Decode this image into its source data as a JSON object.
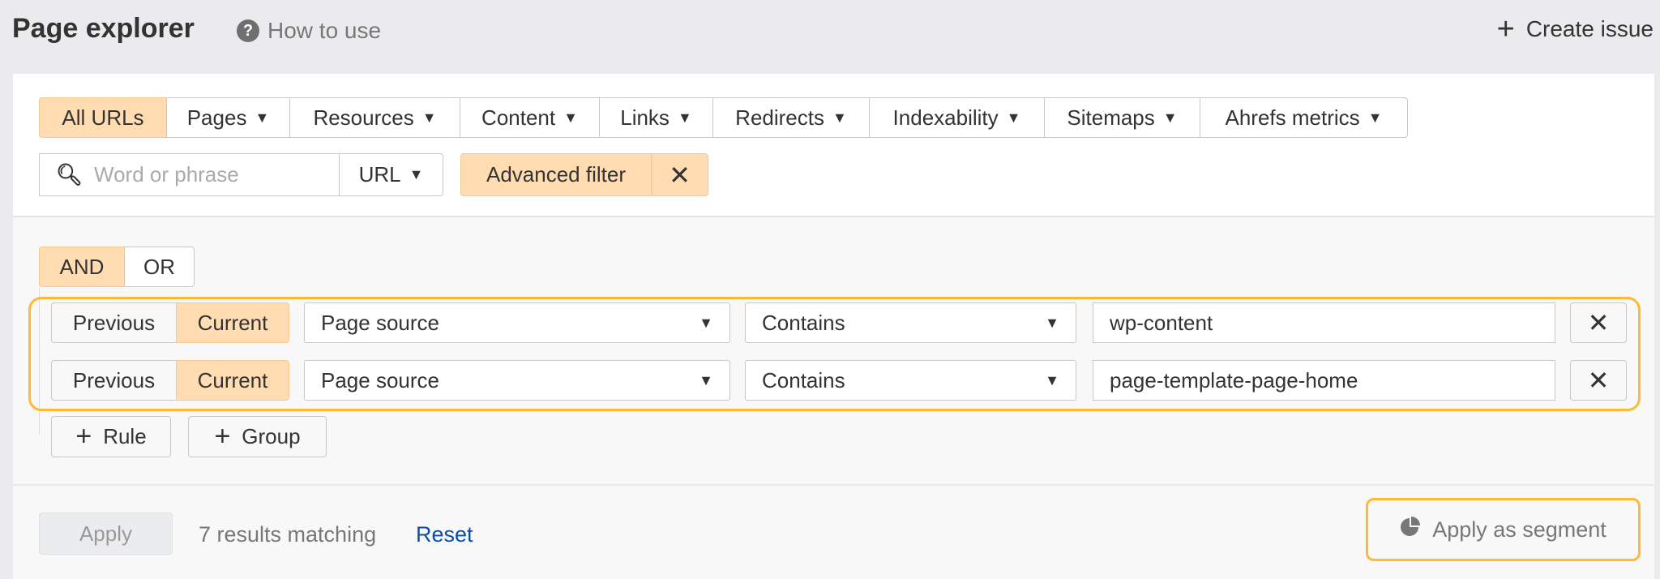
{
  "header": {
    "title": "Page explorer",
    "help_label": "How to use",
    "create_issue_label": "Create issue"
  },
  "tabs": [
    {
      "label": "All URLs",
      "active": true
    },
    {
      "label": "Pages"
    },
    {
      "label": "Resources"
    },
    {
      "label": "Content"
    },
    {
      "label": "Links"
    },
    {
      "label": "Redirects"
    },
    {
      "label": "Indexability"
    },
    {
      "label": "Sitemaps"
    },
    {
      "label": "Ahrefs metrics"
    }
  ],
  "search": {
    "placeholder": "Word or phrase",
    "scope": "URL"
  },
  "advanced_filter": {
    "label": "Advanced filter"
  },
  "logic": {
    "and": "AND",
    "or": "OR",
    "selected": "AND"
  },
  "rules": [
    {
      "previous": "Previous",
      "current": "Current",
      "field": "Page source",
      "operator": "Contains",
      "value": "wp-content"
    },
    {
      "previous": "Previous",
      "current": "Current",
      "field": "Page source",
      "operator": "Contains",
      "value": "page-template-page-home"
    }
  ],
  "add": {
    "rule": "Rule",
    "group": "Group"
  },
  "footer": {
    "apply": "Apply",
    "results": "7 results matching",
    "reset": "Reset",
    "apply_segment": "Apply as segment"
  },
  "colors": {
    "accent": "#ffdcb1",
    "highlight": "#ffb933",
    "link": "#0b4ea2"
  }
}
